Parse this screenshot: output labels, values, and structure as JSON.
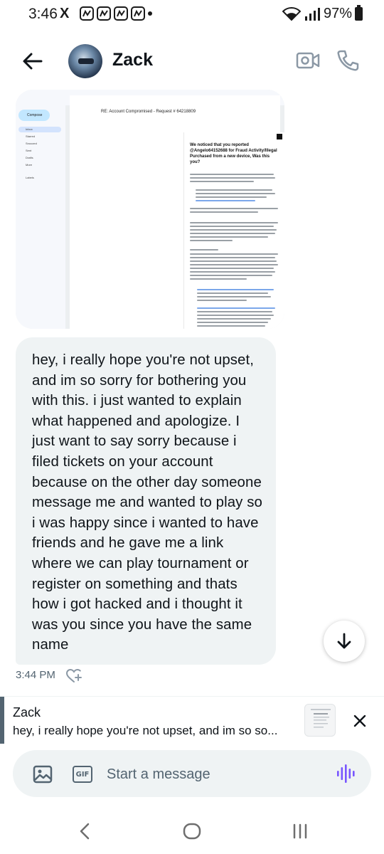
{
  "status_bar": {
    "time": "3:46",
    "x_logo": "X",
    "battery": "97%"
  },
  "header": {
    "contact_name": "Zack",
    "back_icon": "arrow-left-icon",
    "video_icon": "video-camera-icon",
    "call_icon": "phone-icon"
  },
  "conversation": {
    "image_message": {
      "subject": "RE: Account Compromised - Request # 64218809",
      "headline": "We noticed that you reported @Angelo64152688 for Fraud Activity/Illegal Purchased from a new device, Was this you?"
    },
    "text_message": "hey, i really hope you're not upset, and im so sorry for bothering you with this. i just wanted to explain what happened and apologize. I just want to say sorry because i filed tickets on your account because on the other day someone message me and wanted to play so i was happy since i wanted to have friends and he gave me a link where we can play tournament or register on something and thats how i got hacked and i thought it was you since you have the same name",
    "timestamp": "3:44 PM"
  },
  "reply_preview": {
    "name": "Zack",
    "text": "hey, i really hope you're not upset, and im so so..."
  },
  "composer": {
    "placeholder": "Start a message",
    "gif_label": "GIF"
  },
  "colors": {
    "accent_voice": "#7856ff",
    "bubble_bg": "#eff3f4",
    "muted": "#536471"
  }
}
